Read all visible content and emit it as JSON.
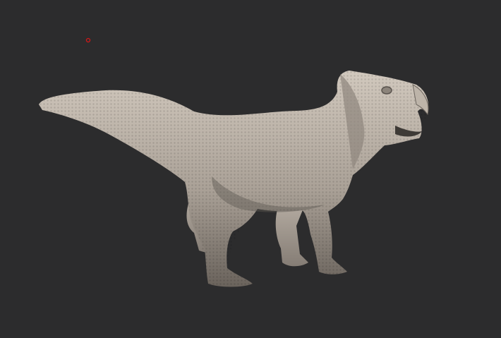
{
  "scene": {
    "subject": "dinosaur-sculpt",
    "colors": {
      "background": "#2c2c2d",
      "model_light": "#cfc6bb",
      "model_mid": "#a89f95",
      "model_dark": "#5e5852",
      "cursor_marker": "#d01818"
    }
  }
}
